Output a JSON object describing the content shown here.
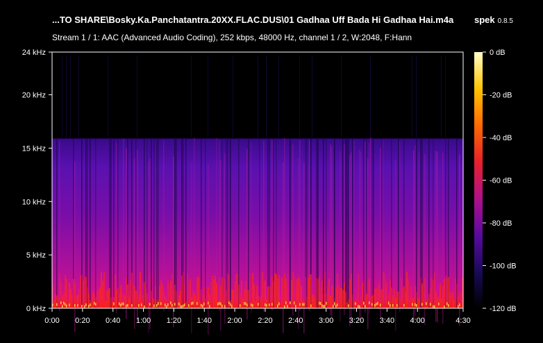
{
  "header": {
    "file_title": "...TO SHARE\\Bosky.Ka.Panchatantra.20XX.FLAC.DUS\\01 Gadhaa Uff Bada Hi Gadhaa Hai.m4a",
    "app_name": "spek",
    "app_version": "0.8.5",
    "stream_info": "Stream 1 / 1: AAC (Advanced Audio Coding), 252 kbps, 48000 Hz, channel 1 / 2, W:2048, F:Hann"
  },
  "chart_data": {
    "type": "heatmap",
    "title": "",
    "freq_axis": {
      "unit": "kHz",
      "range": [
        0,
        24
      ],
      "ticks": [
        {
          "value": 0,
          "label": "0 kHz"
        },
        {
          "value": 5,
          "label": "5 kHz"
        },
        {
          "value": 10,
          "label": "10 kHz"
        },
        {
          "value": 15,
          "label": "15 kHz"
        },
        {
          "value": 20,
          "label": "20 kHz"
        },
        {
          "value": 24,
          "label": "24 kHz"
        }
      ]
    },
    "time_axis": {
      "unit": "s",
      "range": [
        0,
        270
      ],
      "ticks": [
        {
          "value": 0,
          "label": "0:00"
        },
        {
          "value": 20,
          "label": "0:20"
        },
        {
          "value": 40,
          "label": "0:40"
        },
        {
          "value": 60,
          "label": "1:00"
        },
        {
          "value": 80,
          "label": "1:20"
        },
        {
          "value": 100,
          "label": "1:40"
        },
        {
          "value": 120,
          "label": "2:00"
        },
        {
          "value": 140,
          "label": "2:20"
        },
        {
          "value": 160,
          "label": "2:40"
        },
        {
          "value": 180,
          "label": "3:00"
        },
        {
          "value": 200,
          "label": "3:20"
        },
        {
          "value": 220,
          "label": "3:40"
        },
        {
          "value": 240,
          "label": "4:00"
        },
        {
          "value": 270,
          "label": "4:30"
        }
      ]
    },
    "colorbar": {
      "unit": "dB",
      "range": [
        -120,
        0
      ],
      "ticks": [
        {
          "value": 0,
          "label": "0 dB"
        },
        {
          "value": -20,
          "label": "-20 dB"
        },
        {
          "value": -40,
          "label": "-40 dB"
        },
        {
          "value": -60,
          "label": "-60 dB"
        },
        {
          "value": -80,
          "label": "-80 dB"
        },
        {
          "value": -100,
          "label": "-100 dB"
        },
        {
          "value": -120,
          "label": "-120 dB"
        }
      ],
      "colors": [
        "#000000",
        "#1a0a5a",
        "#5a0aa0",
        "#b0108a",
        "#e8202a",
        "#ff6a00",
        "#ffc400",
        "#ffffc8"
      ]
    },
    "spectral_cutoff_khz": 16
  }
}
